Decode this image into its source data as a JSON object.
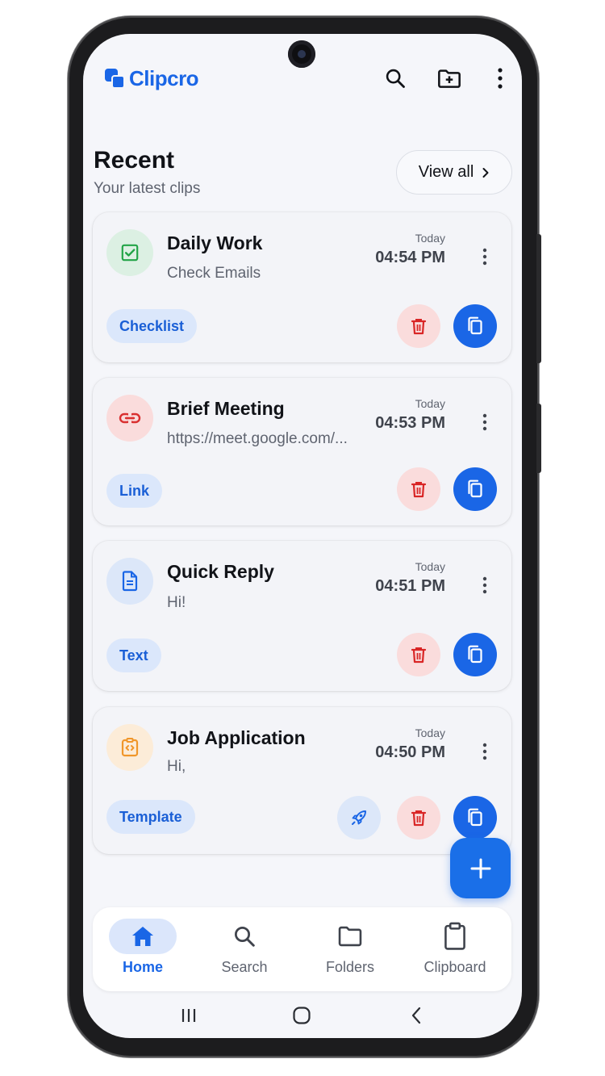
{
  "app": {
    "name": "Clipcro",
    "accent_color": "#1a66e6",
    "top_actions": [
      "search-icon",
      "create-folder-icon",
      "more-vertical-icon"
    ]
  },
  "section": {
    "title": "Recent",
    "subtitle": "Your latest clips",
    "view_all_label": "View all"
  },
  "clips": [
    {
      "title": "Daily Work",
      "preview": "Check Emails",
      "day": "Today",
      "time": "04:54 PM",
      "tag": "Checklist",
      "icon": "checklist-icon",
      "icon_color": "#22a447",
      "icon_bg": "#dcf0e3",
      "actions": [
        "delete",
        "copy"
      ]
    },
    {
      "title": "Brief Meeting",
      "preview": "https://meet.google.com/...",
      "day": "Today",
      "time": "04:53 PM",
      "tag": "Link",
      "icon": "link-icon",
      "icon_color": "#d93030",
      "icon_bg": "#fadcdc",
      "actions": [
        "delete",
        "copy"
      ]
    },
    {
      "title": "Quick Reply",
      "preview": "Hi!",
      "day": "Today",
      "time": "04:51 PM",
      "tag": "Text",
      "icon": "document-icon",
      "icon_color": "#1a66e6",
      "icon_bg": "#dce7f9",
      "actions": [
        "delete",
        "copy"
      ]
    },
    {
      "title": "Job Application",
      "preview": "Hi,",
      "day": "Today",
      "time": "04:50 PM",
      "tag": "Template",
      "icon": "template-icon",
      "icon_color": "#f0962a",
      "icon_bg": "#fcecd8",
      "actions": [
        "launch",
        "delete",
        "copy"
      ]
    }
  ],
  "fab": {
    "icon": "plus-icon"
  },
  "bottom_nav": {
    "items": [
      {
        "label": "Home",
        "icon": "home-icon",
        "active": true
      },
      {
        "label": "Search",
        "icon": "search-icon",
        "active": false
      },
      {
        "label": "Folders",
        "icon": "folder-icon",
        "active": false
      },
      {
        "label": "Clipboard",
        "icon": "clipboard-icon",
        "active": false
      }
    ]
  },
  "system_nav": [
    "recents-icon",
    "home-circle-icon",
    "back-icon"
  ]
}
